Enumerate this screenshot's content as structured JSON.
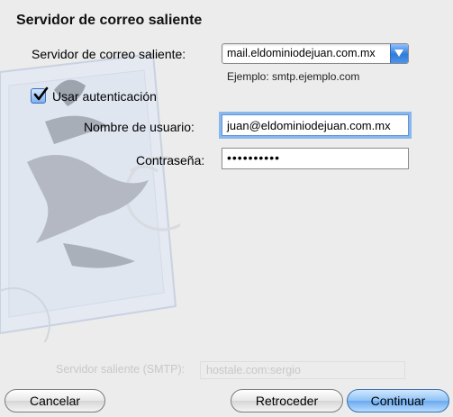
{
  "section_title": "Servidor de correo saliente",
  "smtp": {
    "label": "Servidor de correo saliente:",
    "value": "mail.eldominiodejuan.com.mx",
    "hint": "Ejemplo: smtp.ejemplo.com"
  },
  "auth": {
    "label": "Usar autenticación",
    "checked": true
  },
  "username": {
    "label": "Nombre de usuario:",
    "value": "juan@eldominiodejuan.com.mx"
  },
  "password": {
    "label": "Contraseña:",
    "value": "••••••••••"
  },
  "background_row": {
    "label": "Servidor saliente (SMTP):",
    "value": "hostale.com:sergio"
  },
  "buttons": {
    "cancel": "Cancelar",
    "back": "Retroceder",
    "continue": "Continuar"
  },
  "colors": {
    "accent": "#6aa9ef",
    "focus_ring": "#8ab8ec"
  }
}
